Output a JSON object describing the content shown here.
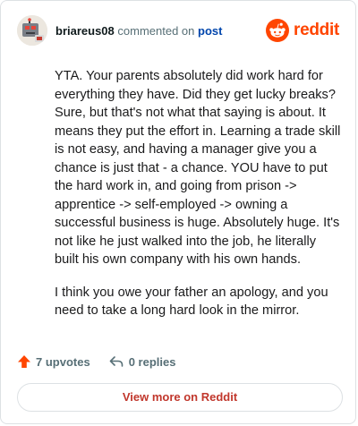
{
  "comment": {
    "username": "briareus08",
    "action_text": "commented on",
    "post_link": "post",
    "paragraphs": [
      "YTA. Your parents absolutely did work hard for everything they have. Did they get lucky breaks? Sure, but that's not what that saying is about. It means they put the effort in. Learning a trade skill is not easy, and having a manager give you a chance is just that - a chance. YOU have to put the hard work in, and going from prison -> apprentice -> self-employed -> owning a successful business is huge. Absolutely huge. It's not like he just walked into the job, he literally built his own company with his own hands.",
      "I think you owe your father an apology, and you need to take a long hard look in the mirror."
    ]
  },
  "brand": {
    "name": "reddit",
    "color": "#ff4500",
    "icon": "reddit-logo-icon"
  },
  "actions": {
    "upvotes": "7 upvotes",
    "replies": "0 replies"
  },
  "view_more": "View more on Reddit",
  "colors": {
    "upvote": "#ff4500",
    "link": "#0045ac",
    "button_text": "#c1372c"
  }
}
